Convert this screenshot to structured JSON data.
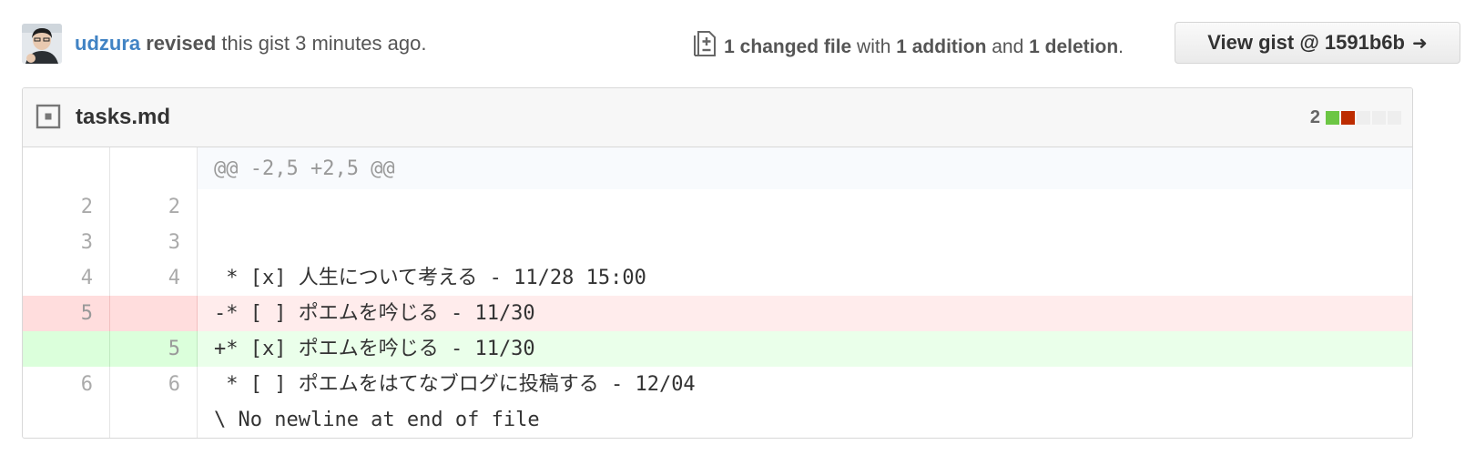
{
  "revision": {
    "user": "udzura",
    "verb": "revised",
    "rest": " this gist 3 minutes ago."
  },
  "diffstat": {
    "changed": "1 changed file",
    "with": " with ",
    "additions": "1 addition",
    "and": " and ",
    "deletions": "1 deletion",
    "period": "."
  },
  "view_button": {
    "label": "View gist @ 1591b6b",
    "arrow": "➜"
  },
  "file": {
    "name": "tasks.md",
    "stat_count": "2",
    "stat_blocks": [
      "#6cc644",
      "#bd2c00",
      "#eeeeee",
      "#eeeeee",
      "#eeeeee"
    ]
  },
  "diff": {
    "hunk": "@@ -2,5 +2,5 @@",
    "lines": [
      {
        "old": "2",
        "new": "2",
        "type": "ctx",
        "text": ""
      },
      {
        "old": "3",
        "new": "3",
        "type": "ctx",
        "text": ""
      },
      {
        "old": "4",
        "new": "4",
        "type": "ctx",
        "text": " * [x] 人生について考える - 11/28 15:00"
      },
      {
        "old": "5",
        "new": "",
        "type": "del",
        "text": "-* [ ] ポエムを吟じる - 11/30"
      },
      {
        "old": "",
        "new": "5",
        "type": "add",
        "text": "+* [x] ポエムを吟じる - 11/30"
      },
      {
        "old": "6",
        "new": "6",
        "type": "ctx",
        "text": " * [ ] ポエムをはてなブログに投稿する - 12/04"
      },
      {
        "old": "",
        "new": "",
        "type": "ctx",
        "text": "\\ No newline at end of file"
      }
    ]
  },
  "colors": {
    "link": "#4183c4",
    "addition": "#6cc644",
    "deletion": "#bd2c00"
  }
}
